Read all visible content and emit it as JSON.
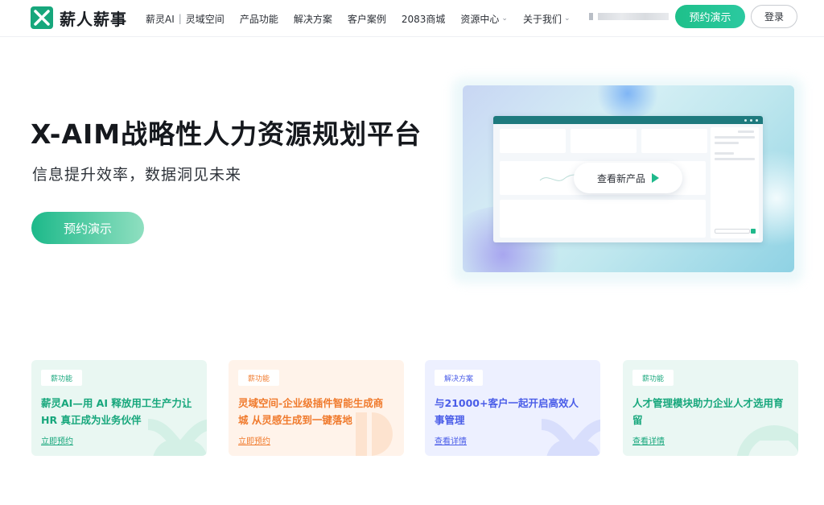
{
  "brand": {
    "name": "薪人薪事",
    "accent": "#1fb98b"
  },
  "nav": {
    "items": [
      {
        "label": "薪灵AI",
        "sep": "|",
        "label2": "灵域空间"
      },
      {
        "label": "产品功能"
      },
      {
        "label": "解决方案"
      },
      {
        "label": "客户案例"
      },
      {
        "label": "2083商城"
      },
      {
        "label": "资源中心",
        "dropdown": true
      },
      {
        "label": "关于我们",
        "dropdown": true
      }
    ],
    "demo_button": "预约演示",
    "login_button": "登录"
  },
  "hero": {
    "title": "X-AIM战略性人力资源规划平台",
    "subtitle": "信息提升效率，数据洞见未来",
    "cta": "预约演示",
    "preview": {
      "cta_label": "查看新产品",
      "play_icon": "play-icon"
    }
  },
  "cards": [
    {
      "tag": "薪功能",
      "title": "薪灵AI—用 AI 释放用工生产力让 HR 真正成为业务伙伴",
      "link": "立即预约",
      "color": "#17a77c"
    },
    {
      "tag": "薪功能",
      "title": "灵域空间-企业级插件智能生成商城 从灵感生成到一键落地",
      "link": "立即预约",
      "color": "#f07a2c"
    },
    {
      "tag": "解决方案",
      "title": "与21000+客户一起开启高效人事管理",
      "link": "查看详情",
      "color": "#4a5de8"
    },
    {
      "tag": "薪功能",
      "title": "人才管理模块助力企业人才选用育留",
      "link": "查看详情",
      "color": "#17a77c"
    }
  ]
}
